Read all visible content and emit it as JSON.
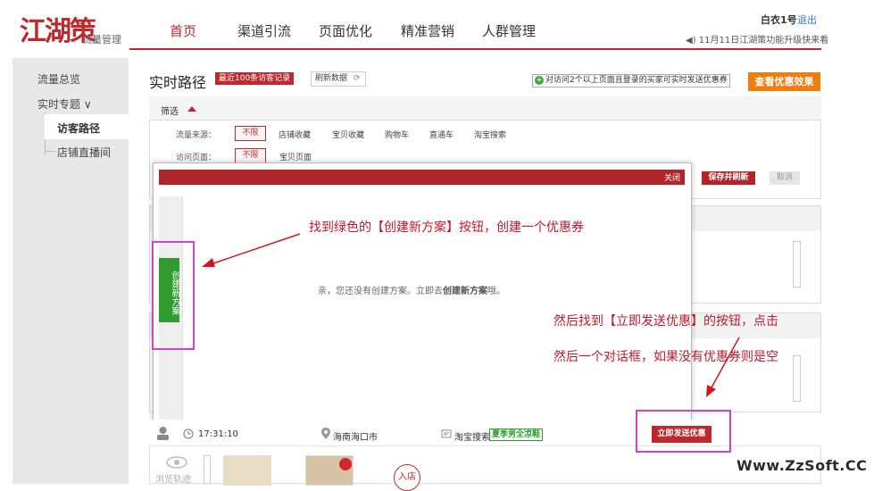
{
  "header": {
    "logo_text": "江湖策",
    "logo_sub": "流量管理",
    "nav": [
      "首页",
      "渠道引流",
      "页面优化",
      "精准营销",
      "人群管理"
    ],
    "active_index": 0,
    "user": "白衣1号",
    "logout": "退出",
    "notice": "11月11日江湖策功能升级快来看"
  },
  "sidebar": {
    "items": [
      "流量总览",
      "实时专题 ∨",
      "访客路径",
      "店铺直播间"
    ]
  },
  "main": {
    "title": "实时路径",
    "badge": "最近100条访客记录",
    "refresh_label": "刷新数据",
    "tip": "对访问2个以上页面且登录的买家可实时发送优惠券",
    "effect_button": "查看优惠效果"
  },
  "filter": {
    "label": "筛选",
    "source_label": "流量来源：",
    "source_options": [
      "不限",
      "店铺收藏",
      "宝贝收藏",
      "购物车",
      "直通车",
      "淘宝搜索"
    ],
    "page_label": "访问页面：",
    "page_options": [
      "不限",
      "宝贝页面"
    ],
    "save_button": "保存并刷新",
    "cancel_button": "取消"
  },
  "modal": {
    "close_label": "关闭",
    "create_button": "创建新方案",
    "empty_prefix": "亲，您还没有创建方案。立即去",
    "empty_link": "创建新方案",
    "empty_suffix": "哦。"
  },
  "annotations": {
    "first": "找到绿色的【创建新方案】按钮，创建一个优惠券",
    "second": "然后找到【立即发送优惠】的按钮，点击",
    "third": "然后一个对话框，如果没有优惠券则是空"
  },
  "visit_row": {
    "time": "17:31:10",
    "location": "海南海口市",
    "source": "淘宝搜索",
    "keyword": "夏季男全凉鞋",
    "send_button": "立即发送优惠",
    "browse_label": "浏览轨迹",
    "enter_label": "入店"
  },
  "watermark": "Www.ZzSoft.CC",
  "colors": {
    "brand_red": "#c0282d",
    "create_green": "#2e9d2e",
    "highlight_magenta": "#d43fd4",
    "effect_orange": "#f07d0e"
  }
}
